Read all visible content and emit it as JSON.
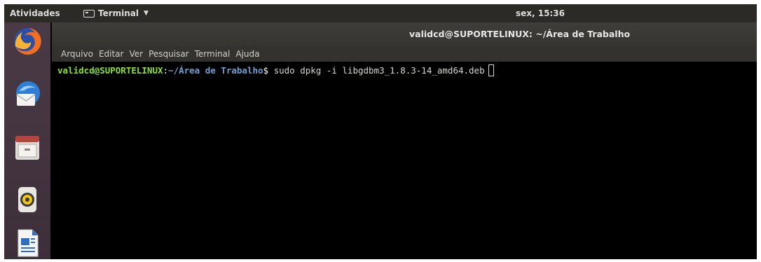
{
  "top_panel": {
    "activities": "Atividades",
    "app_name": "Terminal",
    "clock": "sex, 15:36"
  },
  "dock": {
    "items": [
      {
        "icon": "firefox-icon",
        "label": "Firefox"
      },
      {
        "icon": "thunderbird-icon",
        "label": "Thunderbird"
      },
      {
        "icon": "files-icon",
        "label": "Arquivos"
      },
      {
        "icon": "rhythmbox-icon",
        "label": "Rhythmbox"
      },
      {
        "icon": "libreoffice-writer-icon",
        "label": "LibreOffice Writer"
      }
    ]
  },
  "window": {
    "title": "validcd@SUPORTELINUX: ~/Área de Trabalho",
    "menu": [
      "Arquivo",
      "Editar",
      "Ver",
      "Pesquisar",
      "Terminal",
      "Ajuda"
    ]
  },
  "terminal": {
    "user_host": "validcd@SUPORTELINUX",
    "separator": ":",
    "path": "~/Área de Trabalho",
    "dollar": "$ ",
    "command": "sudo dpkg -i libgdbm3_1.8.3-14_amd64.deb"
  },
  "colors": {
    "prompt_user": "#8ae234",
    "prompt_path": "#729fcf",
    "terminal_bg": "#000000",
    "panel_bg": "#2b2a27",
    "dock_bg": "#4a3a45"
  }
}
